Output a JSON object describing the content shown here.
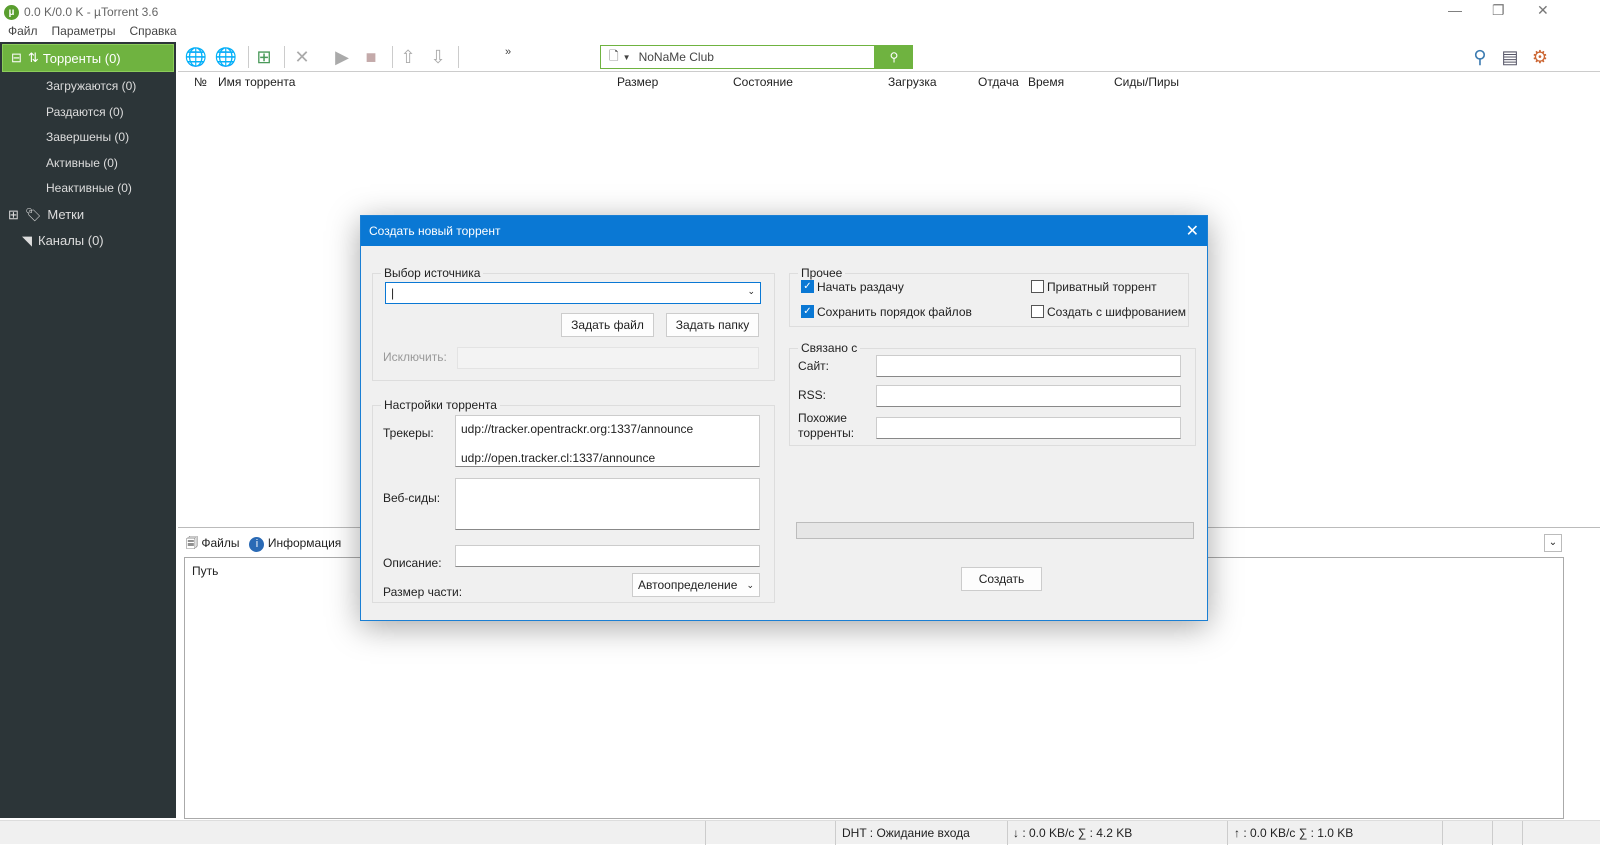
{
  "window": {
    "title": "0.0 K/0.0 K - µTorrent 3.6"
  },
  "menu": [
    "Файл",
    "Параметры",
    "Справка"
  ],
  "sidebar": {
    "torrents": "Торренты (0)",
    "items": [
      "Загружаются (0)",
      "Раздаются (0)",
      "Завершены (0)",
      "Активные (0)",
      "Неактивные (0)"
    ],
    "labels": "Метки",
    "feeds": "Каналы (0)"
  },
  "toolbar": {
    "more": "»",
    "search_value": "NoNaMe Club"
  },
  "columns": [
    "№",
    "Имя торрента",
    "Размер",
    "Состояние",
    "Загрузка",
    "Отдача",
    "Время",
    "Сиды/Пиры"
  ],
  "bottom": {
    "tabs": [
      "Файлы",
      "Информация"
    ],
    "path_header": "Путь"
  },
  "status": {
    "dht": "DHT : Ожидание входа",
    "down": "↓ : 0.0 KB/c  ∑ : 4.2 KB",
    "up": "↑ : 0.0 KB/c  ∑ : 1.0 KB"
  },
  "dialog": {
    "title": "Создать новый торрент",
    "source_group": "Выбор источника",
    "set_file": "Задать файл",
    "set_folder": "Задать папку",
    "exclude": "Исключить:",
    "settings_group": "Настройки торрента",
    "trackers_label": "Трекеры:",
    "trackers": [
      "udp://tracker.opentrackr.org:1337/announce",
      "udp://open.tracker.cl:1337/announce"
    ],
    "webseeds_label": "Веб-сиды:",
    "description_label": "Описание:",
    "piece_size_label": "Размер части:",
    "piece_size": "Автоопределение",
    "other_group": "Прочее",
    "start_seeding": "Начать раздачу",
    "private": "Приватный торрент",
    "preserve_order": "Сохранить порядок файлов",
    "encrypt": "Создать с шифрованием",
    "checks": {
      "start_seeding": true,
      "private": false,
      "preserve_order": true,
      "encrypt": false
    },
    "related_group": "Связано с",
    "site": "Сайт:",
    "rss": "RSS:",
    "similar": "Похожие торренты:",
    "create": "Создать"
  }
}
